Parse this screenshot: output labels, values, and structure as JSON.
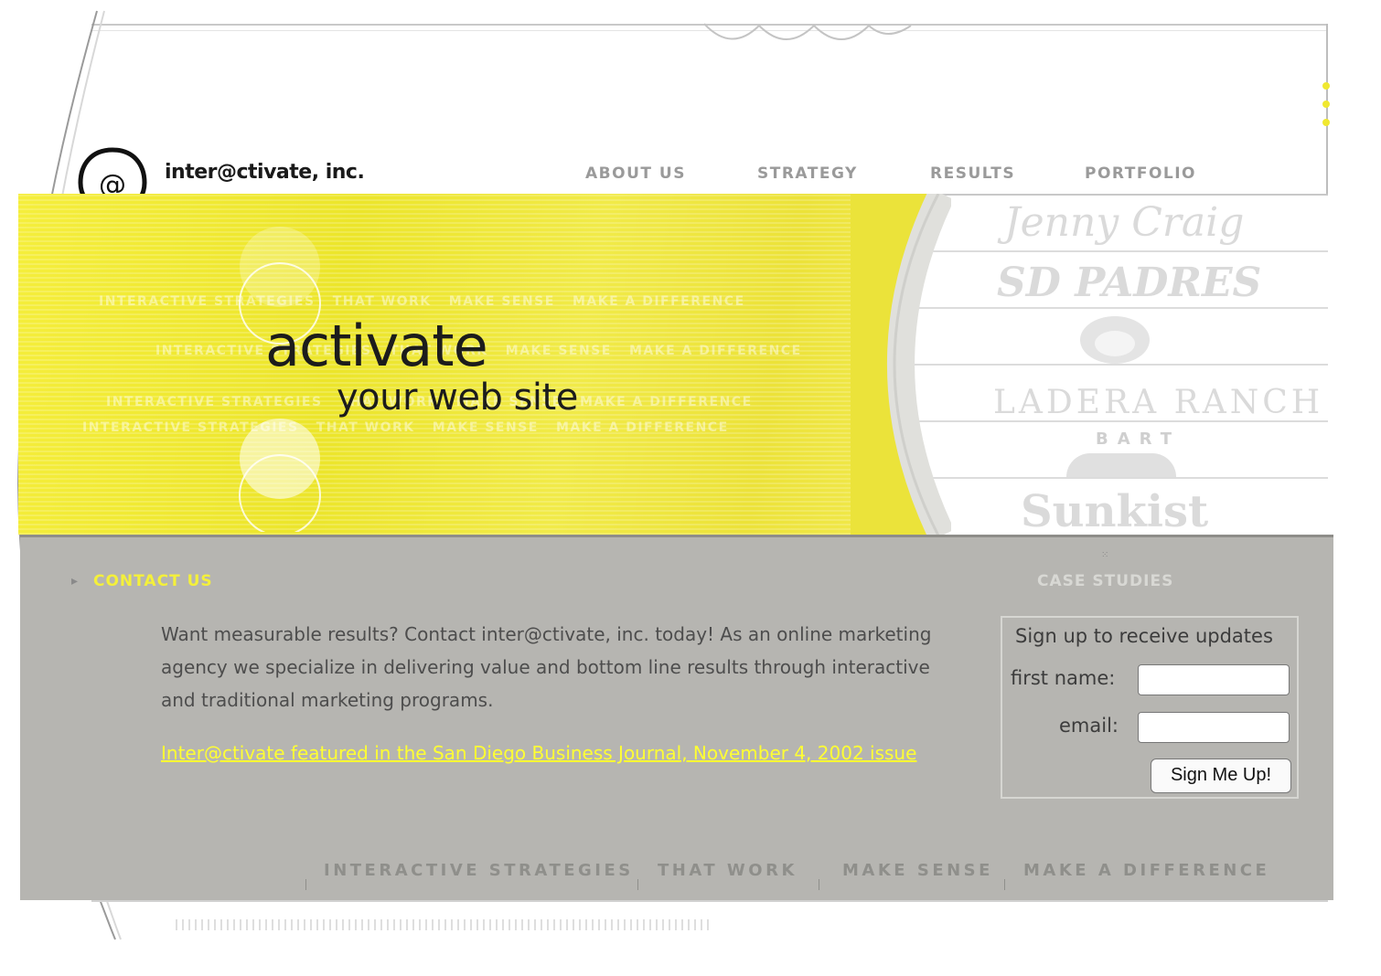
{
  "brand": {
    "name": "inter@ctivate, inc."
  },
  "nav": {
    "items": [
      {
        "label": "ABOUT US"
      },
      {
        "label": "STRATEGY"
      },
      {
        "label": "RESULTS"
      },
      {
        "label": "PORTFOLIO"
      }
    ]
  },
  "hero": {
    "headline": "activate",
    "subheadline": "your web site",
    "ghost_text": [
      "INTERACTIVE STRATEGIES",
      "THAT WORK",
      "MAKE SENSE",
      "MAKE A DIFFERENCE"
    ]
  },
  "clients": {
    "logos": [
      "Jenny Craig",
      "SD PADRES",
      "",
      "LADERA RANCH",
      "BART",
      "Sunkist"
    ]
  },
  "contact": {
    "title": "CONTACT US",
    "body": "Want measurable results? Contact inter@ctivate, inc. today! As an online marketing agency we specialize in delivering value and bottom line results through interactive and traditional marketing programs.",
    "news_link": "Inter@ctivate featured in the San Diego Business Journal, November 4, 2002 issue"
  },
  "case_studies": {
    "title": "CASE STUDIES"
  },
  "signup": {
    "title": "Sign up to receive updates",
    "first_name_label": "first name:",
    "email_label": "email:",
    "first_name_value": "",
    "email_value": "",
    "button_label": "Sign Me Up!"
  },
  "tagline": [
    "INTERACTIVE STRATEGIES",
    "THAT WORK",
    "MAKE SENSE",
    "MAKE A DIFFERENCE"
  ],
  "colors": {
    "accent_yellow": "#f4f03a",
    "band_gray": "#b6b5b1",
    "link_yellow": "#ffff33"
  }
}
